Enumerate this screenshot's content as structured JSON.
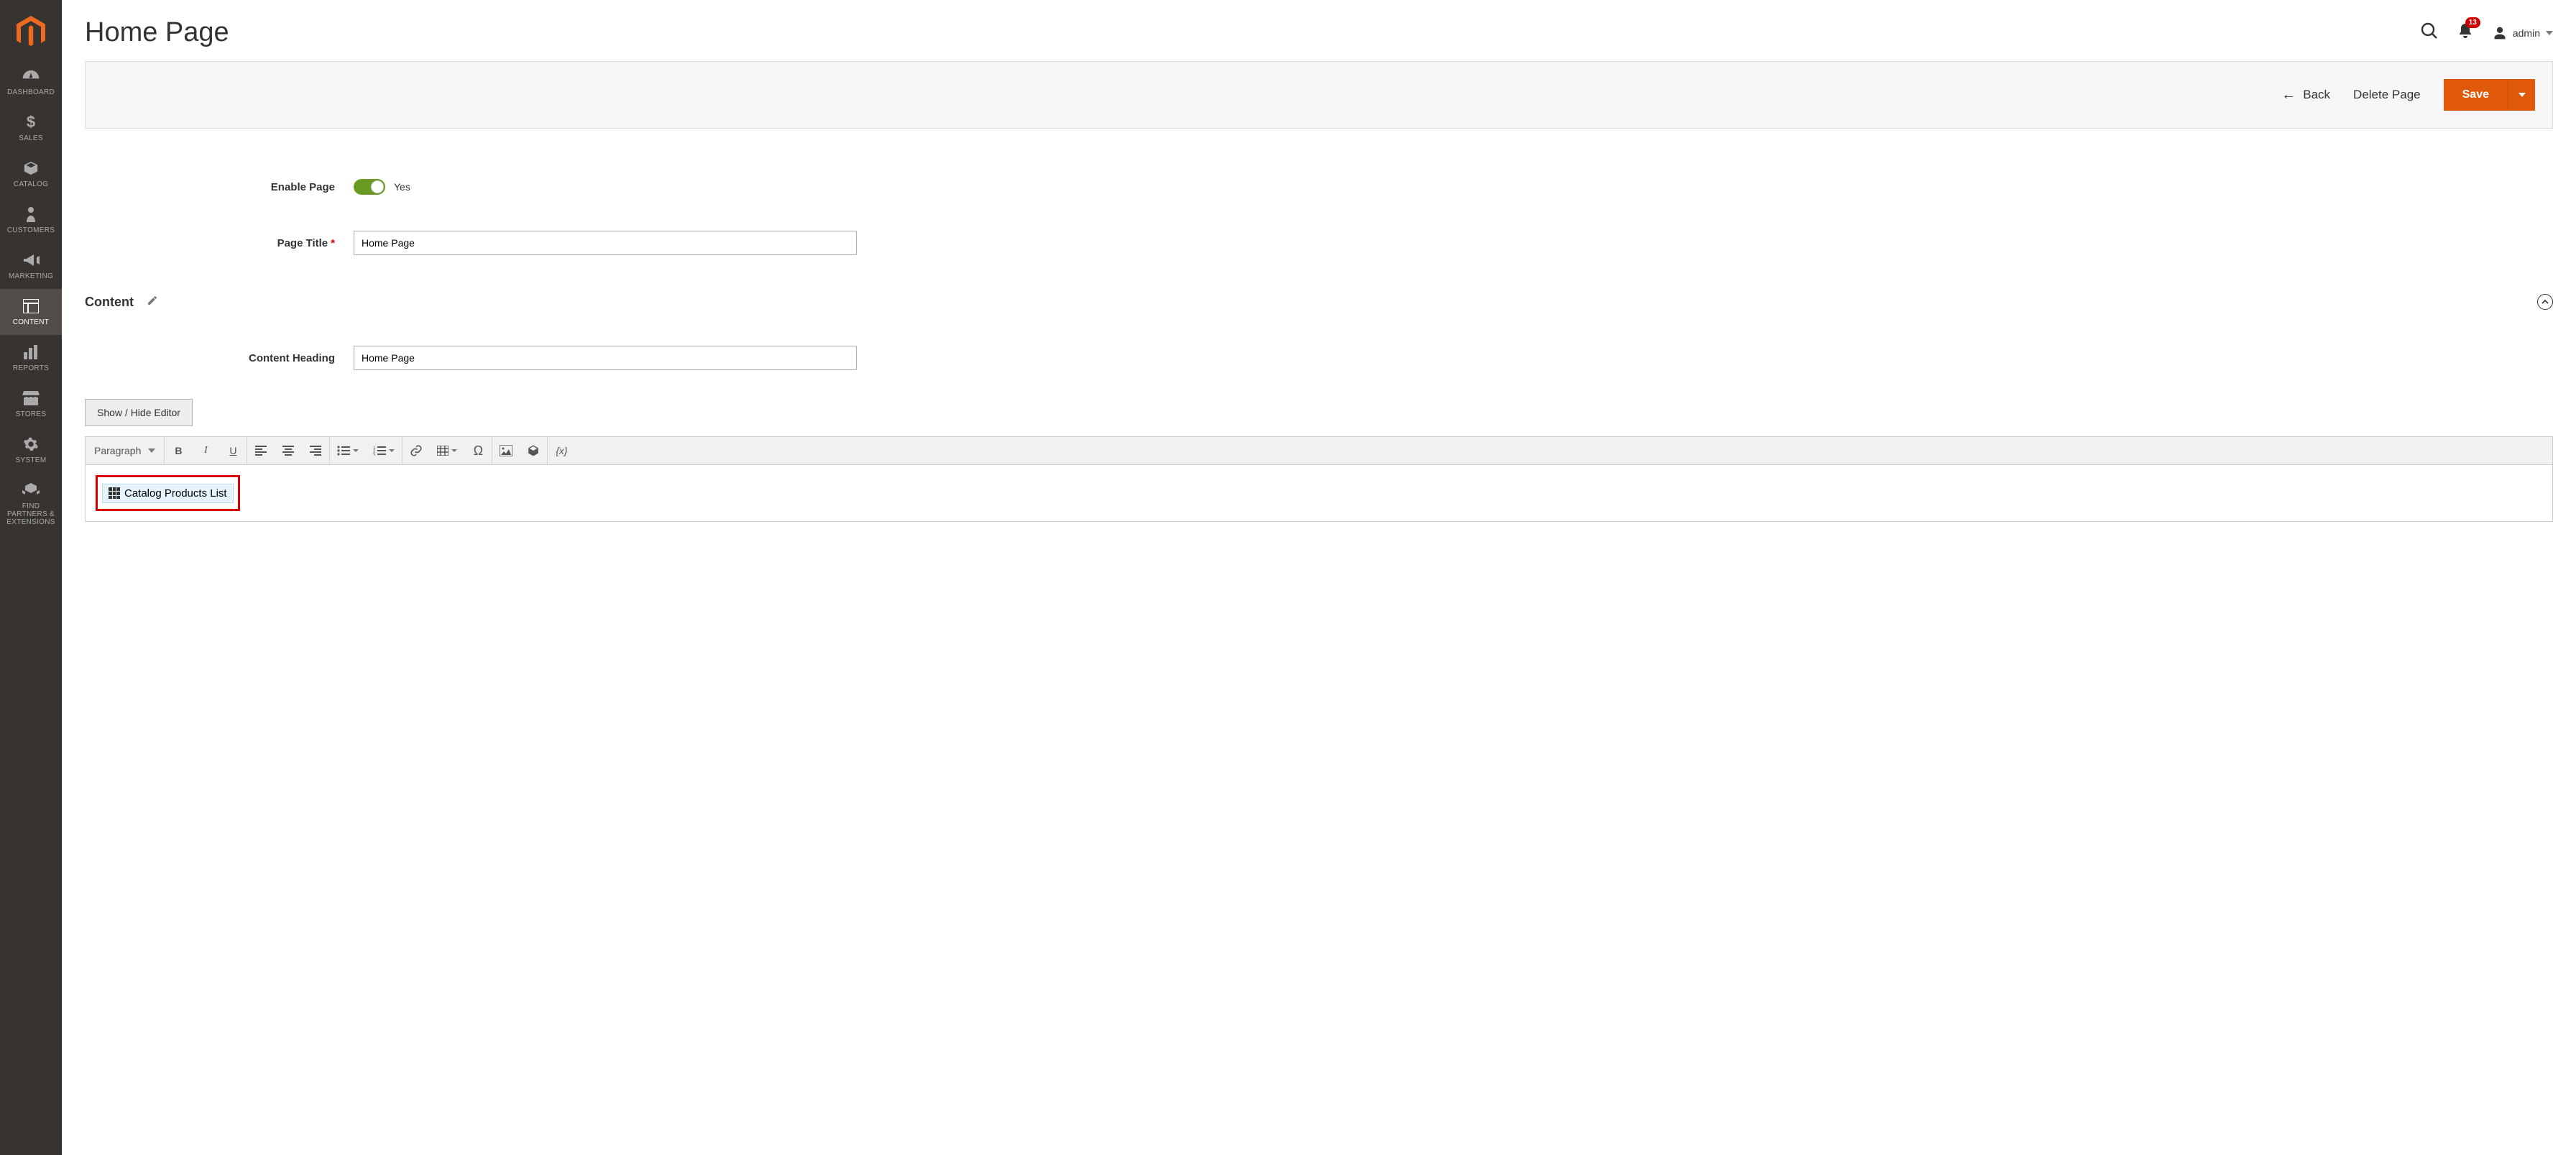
{
  "header": {
    "title": "Home Page",
    "notification_count": "13",
    "username": "admin"
  },
  "actions": {
    "back": "Back",
    "delete": "Delete Page",
    "save": "Save"
  },
  "sidebar": {
    "items": [
      {
        "label": "DASHBOARD"
      },
      {
        "label": "SALES"
      },
      {
        "label": "CATALOG"
      },
      {
        "label": "CUSTOMERS"
      },
      {
        "label": "MARKETING"
      },
      {
        "label": "CONTENT"
      },
      {
        "label": "REPORTS"
      },
      {
        "label": "STORES"
      },
      {
        "label": "SYSTEM"
      },
      {
        "label": "FIND PARTNERS & EXTENSIONS"
      }
    ]
  },
  "form": {
    "enable_label": "Enable Page",
    "enable_value": "Yes",
    "title_label": "Page Title",
    "title_value": "Home Page"
  },
  "content_section": {
    "heading": "Content",
    "content_heading_label": "Content Heading",
    "content_heading_value": "Home Page",
    "toggle_editor_btn": "Show / Hide Editor",
    "block_format": "Paragraph",
    "widget_label": "Catalog Products List"
  }
}
